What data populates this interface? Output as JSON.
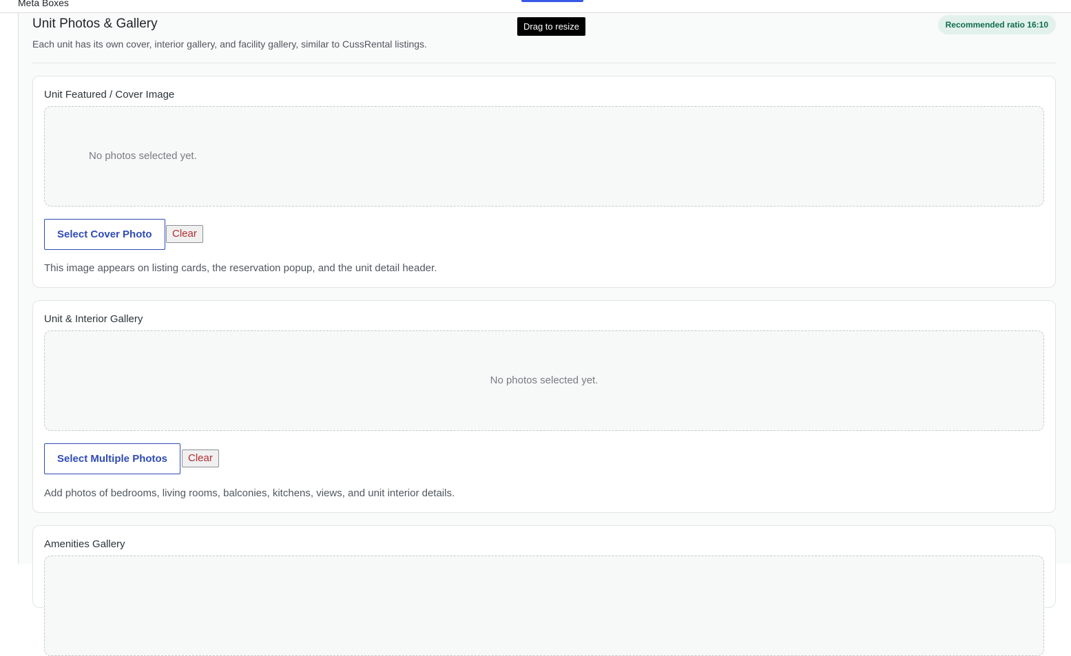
{
  "topbar": {
    "title": "Meta Boxes"
  },
  "tooltip": {
    "text": "Drag to resize"
  },
  "section": {
    "title": "Unit Photos & Gallery",
    "description": "Each unit has its own cover, interior gallery, and facility gallery, similar to CussRental listings.",
    "badge": "Recommended ratio 16:10"
  },
  "cover": {
    "label": "Unit Featured / Cover Image",
    "empty_text": "No photos selected yet.",
    "select_label": "Select Cover Photo",
    "clear_label": "Clear",
    "help": "This image appears on listing cards, the reservation popup, and the unit detail header."
  },
  "interior": {
    "label": "Unit & Interior Gallery",
    "empty_text": "No photos selected yet.",
    "select_label": "Select Multiple Photos",
    "clear_label": "Clear",
    "help": "Add photos of bedrooms, living rooms, balconies, kitchens, views, and unit interior details."
  },
  "amenities": {
    "label": "Amenities Gallery"
  }
}
